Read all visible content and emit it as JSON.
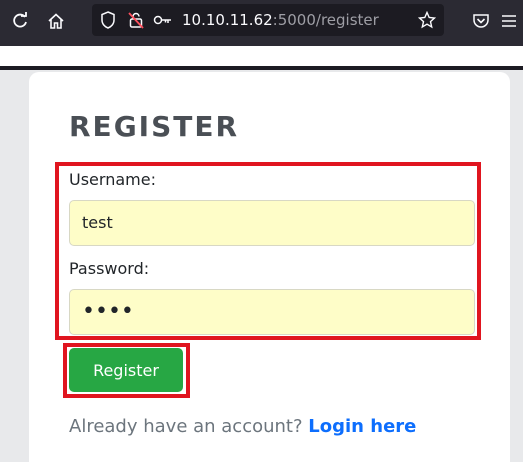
{
  "browser": {
    "url_host": "10.10.11.62",
    "url_rest": ":5000/register",
    "icons": [
      "reload-icon",
      "home-icon",
      "shield-icon",
      "lock-slash-icon",
      "key-icon",
      "star-icon",
      "pocket-icon",
      "menu-icon"
    ]
  },
  "page": {
    "title": "REGISTER",
    "username_label": "Username:",
    "username_value": "test",
    "password_label": "Password:",
    "password_value": "••••",
    "register_button": "Register",
    "already_text": "Already have an account?",
    "login_link": "Login here"
  },
  "colors": {
    "highlight": "#e0151f",
    "button": "#27a744",
    "link": "#0d6efd",
    "field_bg": "#fefdc8"
  }
}
